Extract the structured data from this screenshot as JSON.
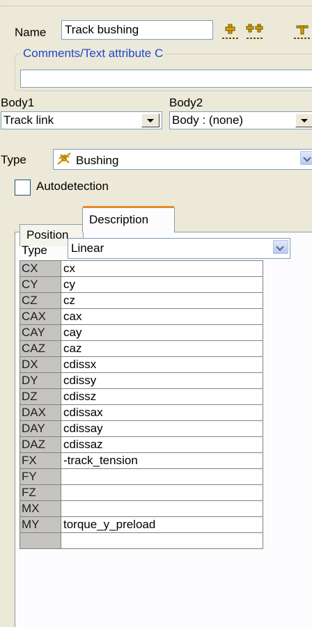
{
  "name": {
    "label": "Name",
    "value": "Track bushing"
  },
  "toolbar": {
    "icons": [
      "add-marker-icon",
      "add-double-marker-icon",
      "edit-marker-icon"
    ]
  },
  "comments": {
    "legend": "Comments/Text attribute C",
    "value": ""
  },
  "bodies": {
    "body1_label": "Body1",
    "body1_value": "Track link",
    "body2_label": "Body2",
    "body2_value": "Body : (none)"
  },
  "type": {
    "label": "Type",
    "value": "Bushing",
    "icon": "bushing-icon"
  },
  "autodetection": {
    "label": "Autodetection",
    "checked": false
  },
  "tabs": [
    {
      "label": "Position",
      "active": false
    },
    {
      "label": "Description",
      "active": true
    }
  ],
  "description": {
    "type_label": "Type",
    "type_value": "Linear",
    "rows": [
      {
        "key": "CX",
        "value": "cx"
      },
      {
        "key": "CY",
        "value": "cy"
      },
      {
        "key": "CZ",
        "value": "cz"
      },
      {
        "key": "CAX",
        "value": "cax"
      },
      {
        "key": "CAY",
        "value": "cay"
      },
      {
        "key": "CAZ",
        "value": "caz"
      },
      {
        "key": "DX",
        "value": "cdissx"
      },
      {
        "key": "DY",
        "value": "cdissy"
      },
      {
        "key": "DZ",
        "value": "cdissz"
      },
      {
        "key": "DAX",
        "value": "cdissax"
      },
      {
        "key": "DAY",
        "value": "cdissay"
      },
      {
        "key": "DAZ",
        "value": "cdissaz"
      },
      {
        "key": "FX",
        "value": "-track_tension"
      },
      {
        "key": "FY",
        "value": ""
      },
      {
        "key": "FZ",
        "value": ""
      },
      {
        "key": "MX",
        "value": ""
      },
      {
        "key": "MY",
        "value": "torque_y_preload"
      },
      {
        "key": "",
        "value": ""
      }
    ]
  },
  "colors": {
    "legend_text": "#1f47d0",
    "active_tab_accent": "#e68b2c",
    "field_border": "#7f9db9",
    "window_bg": "#ece9d8",
    "grid_header_bg": "#c6c4c0"
  }
}
